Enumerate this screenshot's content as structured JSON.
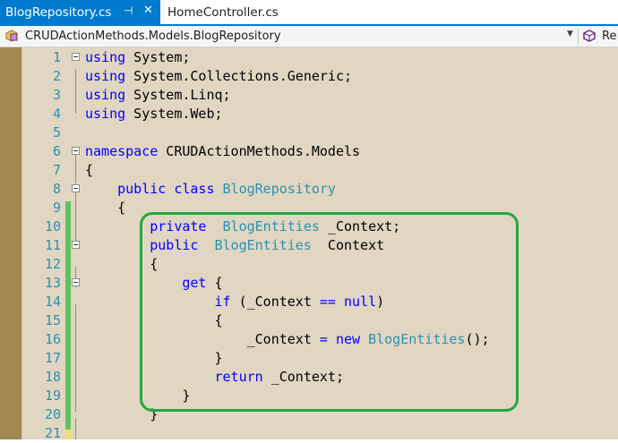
{
  "tabs": [
    {
      "title": "BlogRepository.cs",
      "active": true,
      "pinned_icon": "pin-icon",
      "close_glyph": "✕"
    },
    {
      "title": "HomeController.cs",
      "active": false
    }
  ],
  "navbar": {
    "project_path": "CRUDActionMethods.Models.BlogRepository",
    "dropdown_glyph": "▼",
    "member_label": "Re"
  },
  "editor": {
    "background": "#e1d6c2",
    "lines": [
      {
        "n": "1",
        "tokens": [
          {
            "t": "using",
            "c": "kw"
          },
          {
            "t": " System;"
          }
        ]
      },
      {
        "n": "2",
        "tokens": [
          {
            "t": "using",
            "c": "kw"
          },
          {
            "t": " System.Collections.Generic;"
          }
        ]
      },
      {
        "n": "3",
        "tokens": [
          {
            "t": "using",
            "c": "kw"
          },
          {
            "t": " System.Linq;"
          }
        ]
      },
      {
        "n": "4",
        "tokens": [
          {
            "t": "using",
            "c": "kw"
          },
          {
            "t": " System.Web;"
          }
        ]
      },
      {
        "n": "5",
        "tokens": []
      },
      {
        "n": "6",
        "tokens": [
          {
            "t": "namespace",
            "c": "kw"
          },
          {
            "t": " CRUDActionMethods.Models"
          }
        ]
      },
      {
        "n": "7",
        "tokens": [
          {
            "t": "{"
          }
        ]
      },
      {
        "n": "8",
        "tokens": [
          {
            "t": "    "
          },
          {
            "t": "public",
            "c": "kw"
          },
          {
            "t": " "
          },
          {
            "t": "class",
            "c": "kw"
          },
          {
            "t": " "
          },
          {
            "t": "BlogRepository",
            "c": "ty"
          }
        ]
      },
      {
        "n": "9",
        "tokens": [
          {
            "t": "    {"
          }
        ]
      },
      {
        "n": "10",
        "tokens": [
          {
            "t": "        "
          },
          {
            "t": "private",
            "c": "kw"
          },
          {
            "t": "  "
          },
          {
            "t": "BlogEntities",
            "c": "ty"
          },
          {
            "t": " _Context;"
          }
        ]
      },
      {
        "n": "11",
        "tokens": [
          {
            "t": "        "
          },
          {
            "t": "public",
            "c": "kw"
          },
          {
            "t": "  "
          },
          {
            "t": "BlogEntities",
            "c": "ty"
          },
          {
            "t": "  Context"
          }
        ]
      },
      {
        "n": "12",
        "tokens": [
          {
            "t": "        {"
          }
        ]
      },
      {
        "n": "13",
        "tokens": [
          {
            "t": "            "
          },
          {
            "t": "get",
            "c": "kw"
          },
          {
            "t": " {"
          }
        ]
      },
      {
        "n": "14",
        "tokens": [
          {
            "t": "                "
          },
          {
            "t": "if",
            "c": "kw"
          },
          {
            "t": " (_Context "
          },
          {
            "t": "==",
            "c": "op"
          },
          {
            "t": " "
          },
          {
            "t": "null",
            "c": "kw"
          },
          {
            "t": ")"
          }
        ]
      },
      {
        "n": "15",
        "tokens": [
          {
            "t": "                {"
          }
        ]
      },
      {
        "n": "16",
        "tokens": [
          {
            "t": "                    _Context "
          },
          {
            "t": "=",
            "c": "op"
          },
          {
            "t": " "
          },
          {
            "t": "new",
            "c": "kw"
          },
          {
            "t": " "
          },
          {
            "t": "BlogEntities",
            "c": "ty"
          },
          {
            "t": "();"
          }
        ]
      },
      {
        "n": "17",
        "tokens": [
          {
            "t": "                }"
          }
        ]
      },
      {
        "n": "18",
        "tokens": [
          {
            "t": "                "
          },
          {
            "t": "return",
            "c": "kw"
          },
          {
            "t": " _Context;"
          }
        ]
      },
      {
        "n": "19",
        "tokens": [
          {
            "t": "            }"
          }
        ]
      },
      {
        "n": "20",
        "tokens": [
          {
            "t": "        }"
          }
        ]
      },
      {
        "n": "21",
        "tokens": []
      }
    ]
  },
  "colors": {
    "tab_active": "#007acc",
    "annotation": "#22a83c",
    "line_number": "#2b91af",
    "keyword": "#0000ff",
    "type": "#2b91af"
  }
}
